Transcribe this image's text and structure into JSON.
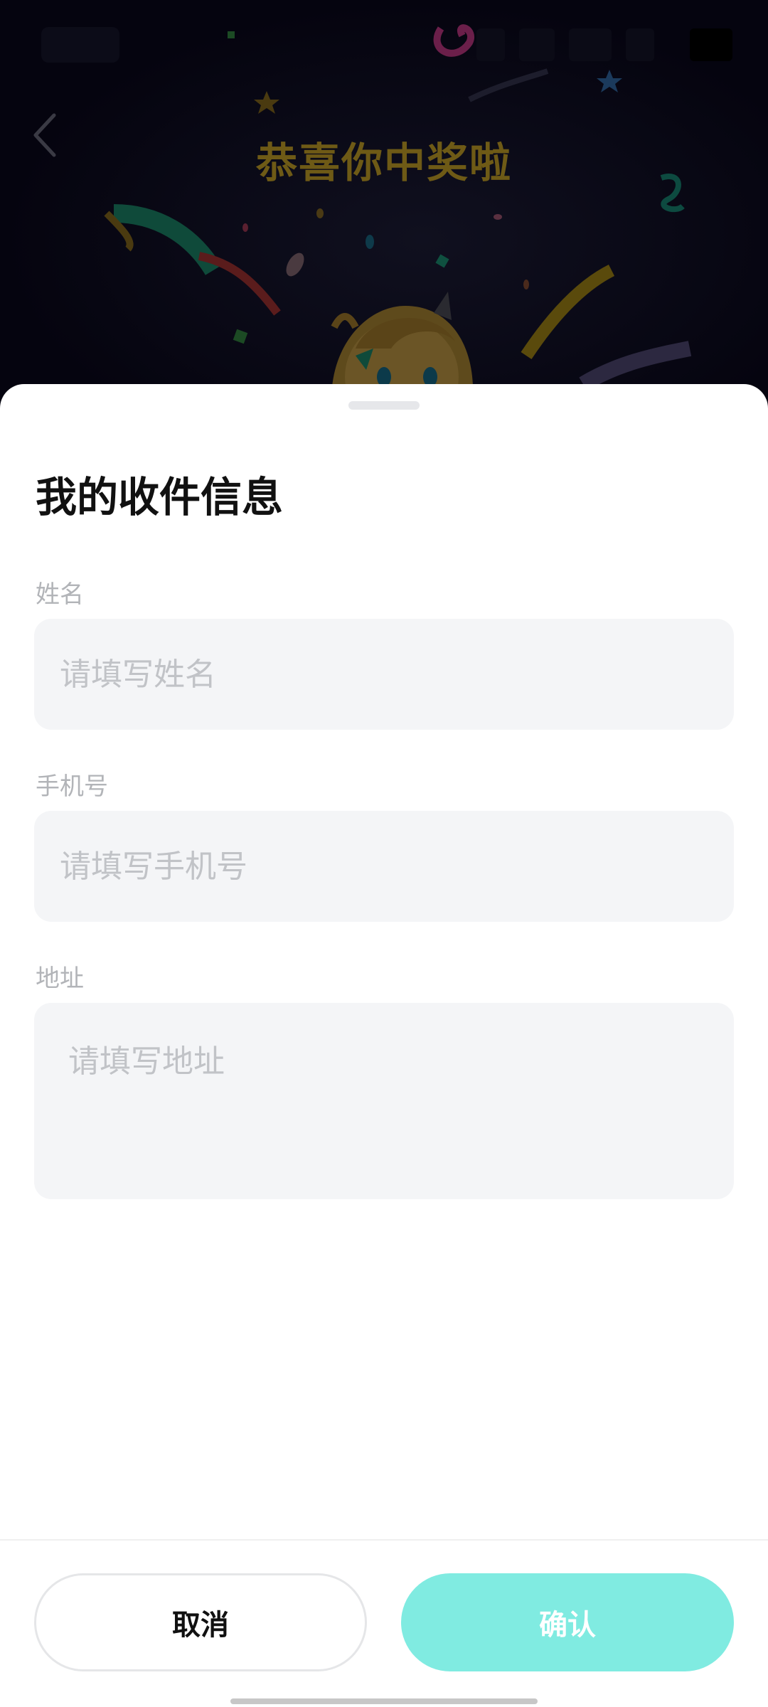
{
  "header": {
    "title": "恭喜你中奖啦",
    "back_icon": "chevron-left-icon"
  },
  "sheet": {
    "title": "我的收件信息",
    "fields": {
      "name": {
        "label": "姓名",
        "placeholder": "请填写姓名",
        "value": ""
      },
      "phone": {
        "label": "手机号",
        "placeholder": "请填写手机号",
        "value": ""
      },
      "address": {
        "label": "地址",
        "placeholder": "请填写地址",
        "value": ""
      }
    }
  },
  "footer": {
    "cancel_label": "取消",
    "confirm_label": "确认"
  },
  "colors": {
    "accent": "#80ebe1",
    "title_gold": "#6e5a16",
    "dim_background": "#05040f"
  }
}
